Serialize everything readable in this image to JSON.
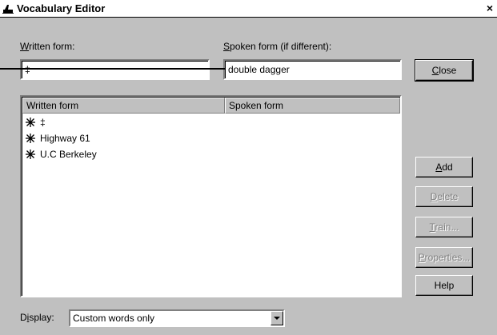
{
  "window": {
    "title": "Vocabulary Editor",
    "close_glyph": "×",
    "icon": "app-icon"
  },
  "written_form": {
    "label_accel": "W",
    "label_rest": "ritten form:",
    "value": "‡"
  },
  "spoken_form": {
    "label_accel": "S",
    "label_rest": "poken form (if different):",
    "value": "double dagger"
  },
  "list": {
    "columns": [
      "Written form",
      "Spoken form"
    ],
    "rows": [
      {
        "written": "‡",
        "spoken": "",
        "icon": "custom-word-icon"
      },
      {
        "written": "Highway 61",
        "spoken": "",
        "icon": "custom-word-icon"
      },
      {
        "written": "U.C Berkeley",
        "spoken": "",
        "icon": "custom-word-icon"
      }
    ]
  },
  "buttons": {
    "close_accel": "C",
    "close_rest": "lose",
    "add_accel": "A",
    "add_rest": "dd",
    "delete_accel": "D",
    "delete_rest": "elete",
    "train_accel": "T",
    "train_rest": "rain...",
    "properties_accel": "P",
    "properties_rest": "roperties...",
    "help": "Help"
  },
  "display": {
    "label_pre": "D",
    "label_accel": "i",
    "label_post": "splay:",
    "value": "Custom words only"
  },
  "colors": {
    "face": "#c0c0c0",
    "disabled_text": "#808080"
  }
}
